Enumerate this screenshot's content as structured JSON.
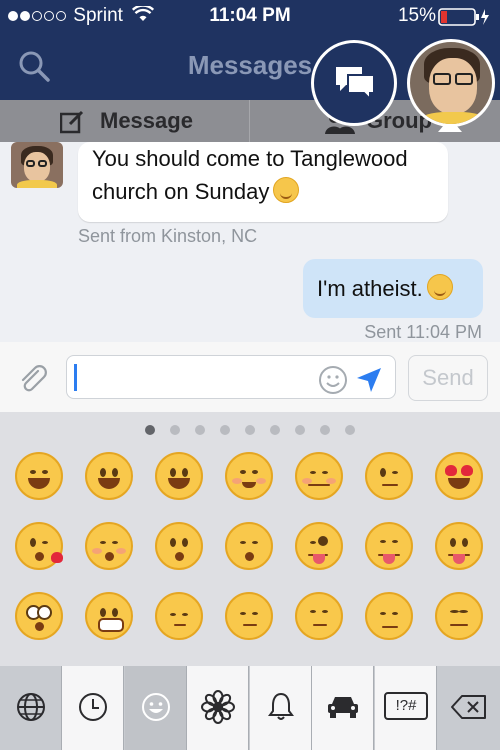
{
  "status_bar": {
    "carrier": "Sprint",
    "time": "11:04 PM",
    "battery": "15%",
    "signal_dots_filled": 2,
    "signal_dots_total": 5
  },
  "nav": {
    "title": "Messages",
    "search_icon": "search-icon",
    "chat_heads_icon": "chat-bubbles-icon"
  },
  "tabs": [
    {
      "label": "Message",
      "icon": "compose-icon"
    },
    {
      "label": "Group",
      "icon": "group-icon"
    }
  ],
  "conversation": {
    "incoming": {
      "text_line1": "You should come to Tanglewood",
      "text_line2": "church on Sunday",
      "meta": "Sent from Kinston, NC"
    },
    "outgoing": {
      "text": "I'm atheist.",
      "meta": "Sent 11:04 PM"
    }
  },
  "composer": {
    "placeholder": "",
    "send_label": "Send",
    "attach_icon": "paperclip-icon",
    "emoji_icon": "smiley-icon",
    "location_icon": "location-arrow-icon"
  },
  "emoji_keyboard": {
    "pages_total": 9,
    "active_page": 1,
    "rows": [
      [
        "grinning-smiling-eyes",
        "smiley",
        "grinning",
        "smiling-eyes",
        "relaxed",
        "wink",
        "heart-eyes"
      ],
      [
        "kissing-heart",
        "kissing-closed-eyes",
        "kissing",
        "kissing-smiling-eyes",
        "tongue-wink",
        "tongue-squint",
        "tongue"
      ],
      [
        "flushed",
        "grimacing",
        "pensive",
        "relieved",
        "unamused",
        "disappointed",
        "confounded"
      ]
    ],
    "category_keys": [
      "globe-icon",
      "recent-clock-icon",
      "smiley-face-icon",
      "flower-icon",
      "bell-icon",
      "car-icon",
      "symbols-icon",
      "delete-backspace-icon"
    ],
    "symbols_label": "!?#",
    "selected_category": 2
  },
  "colors": {
    "nav_background": "#1f3361",
    "outgoing_bubble": "#cfe4f8",
    "caret": "#2c7df0",
    "location_arrow": "#2c7df0"
  }
}
